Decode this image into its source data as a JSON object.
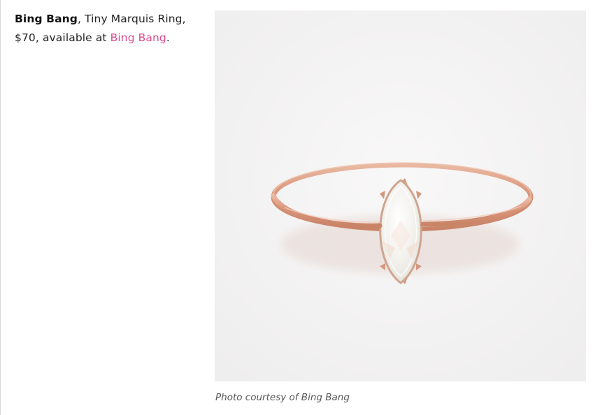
{
  "product": {
    "brand": "Bing Bang",
    "description": ", Tiny Marquis Ring,",
    "price_prefix": "$70, available at",
    "store_link": "Bing Bang",
    "trailing": "."
  },
  "image": {
    "credit": "Photo courtesy of Bing Bang"
  },
  "colors": {
    "link": "#d94b8c",
    "ring": "#d99e84",
    "stone": "#f1f0ec",
    "background": "#f5f4f4"
  }
}
